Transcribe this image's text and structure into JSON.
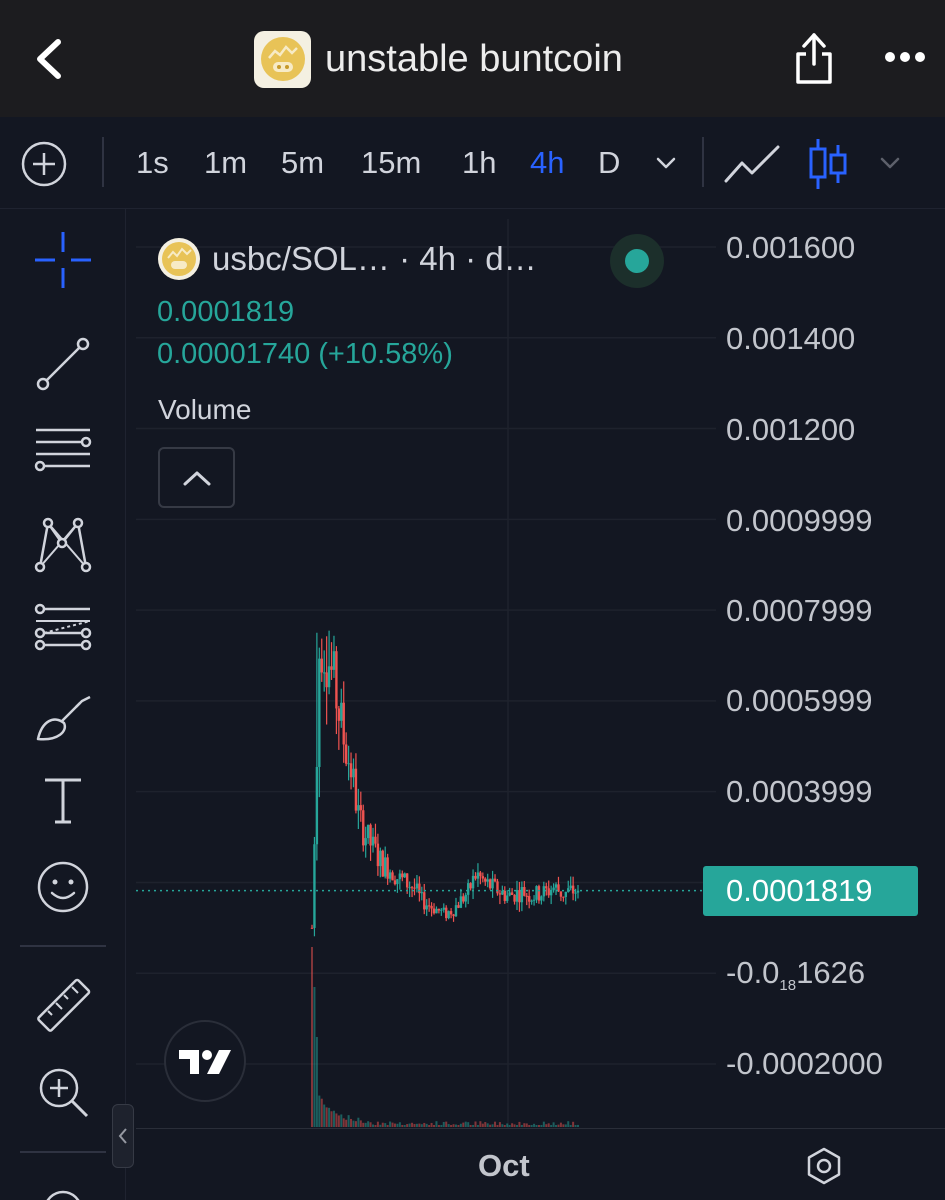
{
  "header": {
    "title": "unstable buntcoin"
  },
  "toolbar": {
    "timeframes": [
      "1s",
      "1m",
      "5m",
      "15m",
      "1h",
      "4h",
      "D"
    ],
    "active_timeframe": "4h"
  },
  "sidebar": {
    "tools": [
      "crosshair-icon",
      "trend-line-icon",
      "horizontal-lines-icon",
      "pattern-icon",
      "fib-channel-icon",
      "brush-icon",
      "text-icon",
      "emoji-icon",
      "ruler-icon",
      "zoom-in-icon",
      "zoom-out-icon"
    ]
  },
  "legend": {
    "title": "usbc/SOL… · 4h · d…",
    "price": "0.0001819",
    "change": "0.00001740 (+10.58%)",
    "volume_label": "Volume"
  },
  "price_axis": {
    "labels": [
      "0.001600",
      "0.001400",
      "0.001200",
      "0.0009999",
      "0.0007999",
      "0.0005999",
      "0.0003999"
    ],
    "last_price": "0.0001819",
    "neg_label_prefix": "-0.0",
    "neg_label_sub": "18",
    "neg_label_suffix": "1626",
    "neg_label_2": "-0.0002000"
  },
  "time_axis": {
    "label": "Oct"
  },
  "colors": {
    "up": "#26a69a",
    "down": "#ef5350",
    "accent": "#2962ff",
    "background": "#131722",
    "header": "#1c1c1f"
  },
  "chart_data": {
    "type": "candlestick",
    "series_name": "usbc/SOL",
    "interval": "4h",
    "ylim": [
      -0.0002,
      0.0016
    ],
    "x_tick_labels": [
      "Oct"
    ],
    "last_price": 0.0001819,
    "peak_high": 0.00075,
    "approx_closes": [
      0.0001,
      0.00075,
      0.0007,
      0.00062,
      0.00052,
      0.00045,
      0.00034,
      0.0003,
      0.00027,
      0.00024,
      0.00023,
      0.00021,
      0.0002,
      0.00019,
      0.00016,
      0.00015,
      0.00014,
      0.00013,
      0.00014,
      0.00016,
      0.00018,
      0.00022,
      0.0002,
      0.00019,
      0.00018,
      0.00017,
      0.000175,
      0.00018,
      0.00017,
      0.000175,
      0.00018,
      0.00019,
      0.000175,
      0.00018,
      0.0001819
    ]
  }
}
